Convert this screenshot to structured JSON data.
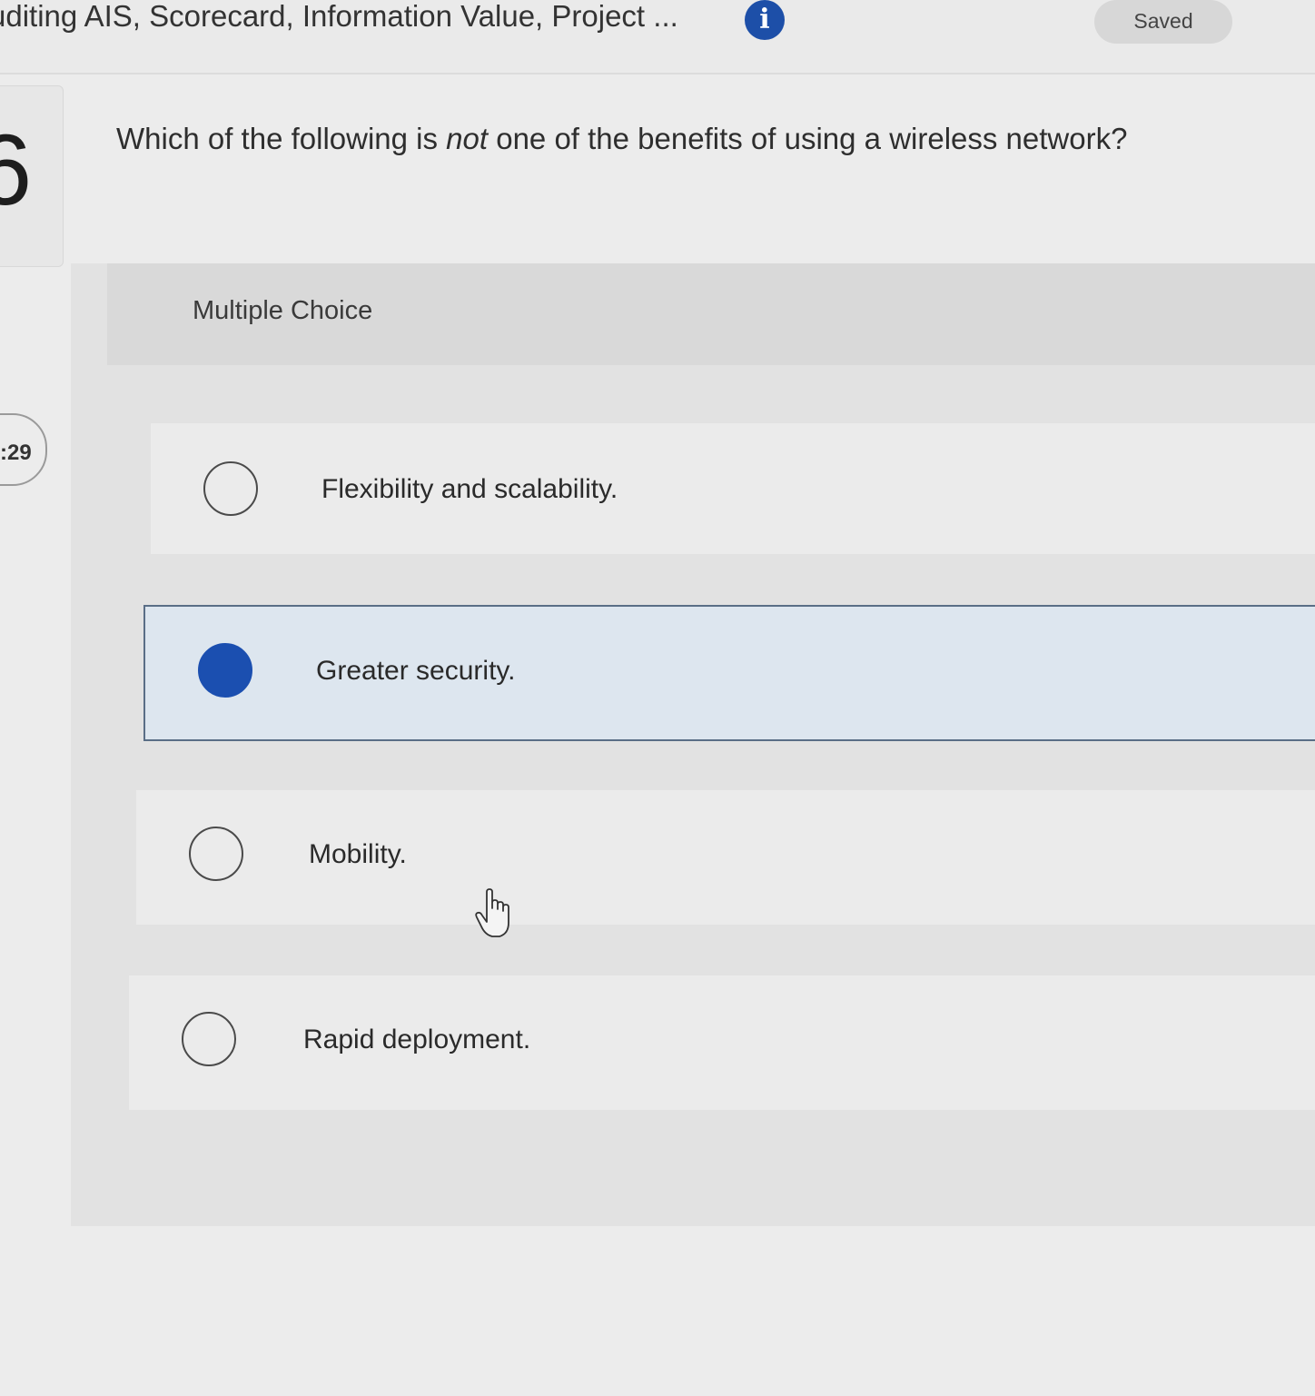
{
  "header": {
    "assignment_title": "uditing AIS, Scorecard, Information Value, Project ...",
    "info_icon": "info-icon",
    "saved_label": "Saved"
  },
  "sidebar": {
    "question_number": "6",
    "timer": ":29"
  },
  "question": {
    "prefix": "Which of the following is ",
    "emphasis": "not",
    "suffix": " one of the benefits of using a wireless network?"
  },
  "answer_area": {
    "type_label": "Multiple Choice",
    "options": [
      {
        "label": "Flexibility and scalability.",
        "selected": false
      },
      {
        "label": "Greater security.",
        "selected": true
      },
      {
        "label": "Mobility.",
        "selected": false
      },
      {
        "label": "Rapid deployment.",
        "selected": false
      }
    ]
  },
  "colors": {
    "accent": "#1b4fb0",
    "selected_bg": "#dde6ef"
  },
  "cursor": "hand-pointer-icon"
}
